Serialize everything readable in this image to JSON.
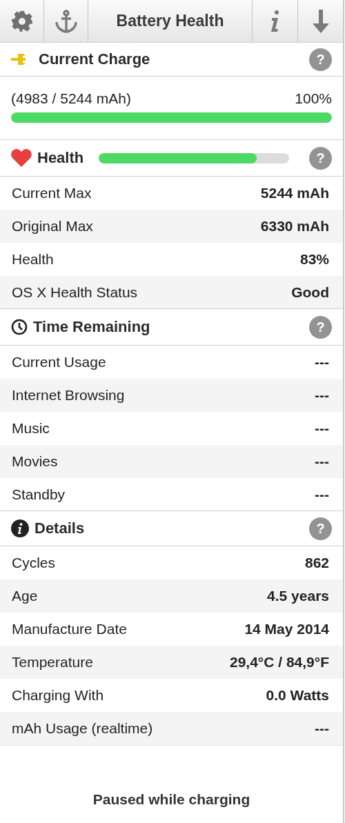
{
  "toolbar": {
    "title": "Battery Health"
  },
  "sections": [
    {
      "kind": "charge",
      "title": "Current Charge",
      "help": "?",
      "reading": "(4983 / 5244 mAh)",
      "percent": "100%",
      "level": 1.0
    },
    {
      "kind": "health",
      "title": "Health",
      "help": "?",
      "level": 0.83,
      "rows": [
        {
          "label": "Current Max",
          "value": "5244 mAh"
        },
        {
          "label": "Original Max",
          "value": "6330 mAh"
        },
        {
          "label": "Health",
          "value": "83%"
        },
        {
          "label": "OS X Health Status",
          "value": "Good"
        }
      ]
    },
    {
      "kind": "time",
      "title": "Time Remaining",
      "help": "?",
      "rows": [
        {
          "label": "Current Usage",
          "value": "---"
        },
        {
          "label": "Internet Browsing",
          "value": "---"
        },
        {
          "label": "Music",
          "value": "---"
        },
        {
          "label": "Movies",
          "value": "---"
        },
        {
          "label": "Standby",
          "value": "---"
        }
      ]
    },
    {
      "kind": "details",
      "title": "Details",
      "help": "?",
      "rows": [
        {
          "label": "Cycles",
          "value": "862"
        },
        {
          "label": "Age",
          "value": "4.5 years"
        },
        {
          "label": "Manufacture Date",
          "value": "14 May 2014"
        },
        {
          "label": "Temperature",
          "value": "29,4°C / 84,9°F"
        },
        {
          "label": "Charging With",
          "value": "0.0 Watts"
        },
        {
          "label": "mAh Usage (realtime)",
          "value": "---"
        }
      ]
    }
  ],
  "footer": {
    "status": "Paused while charging"
  }
}
